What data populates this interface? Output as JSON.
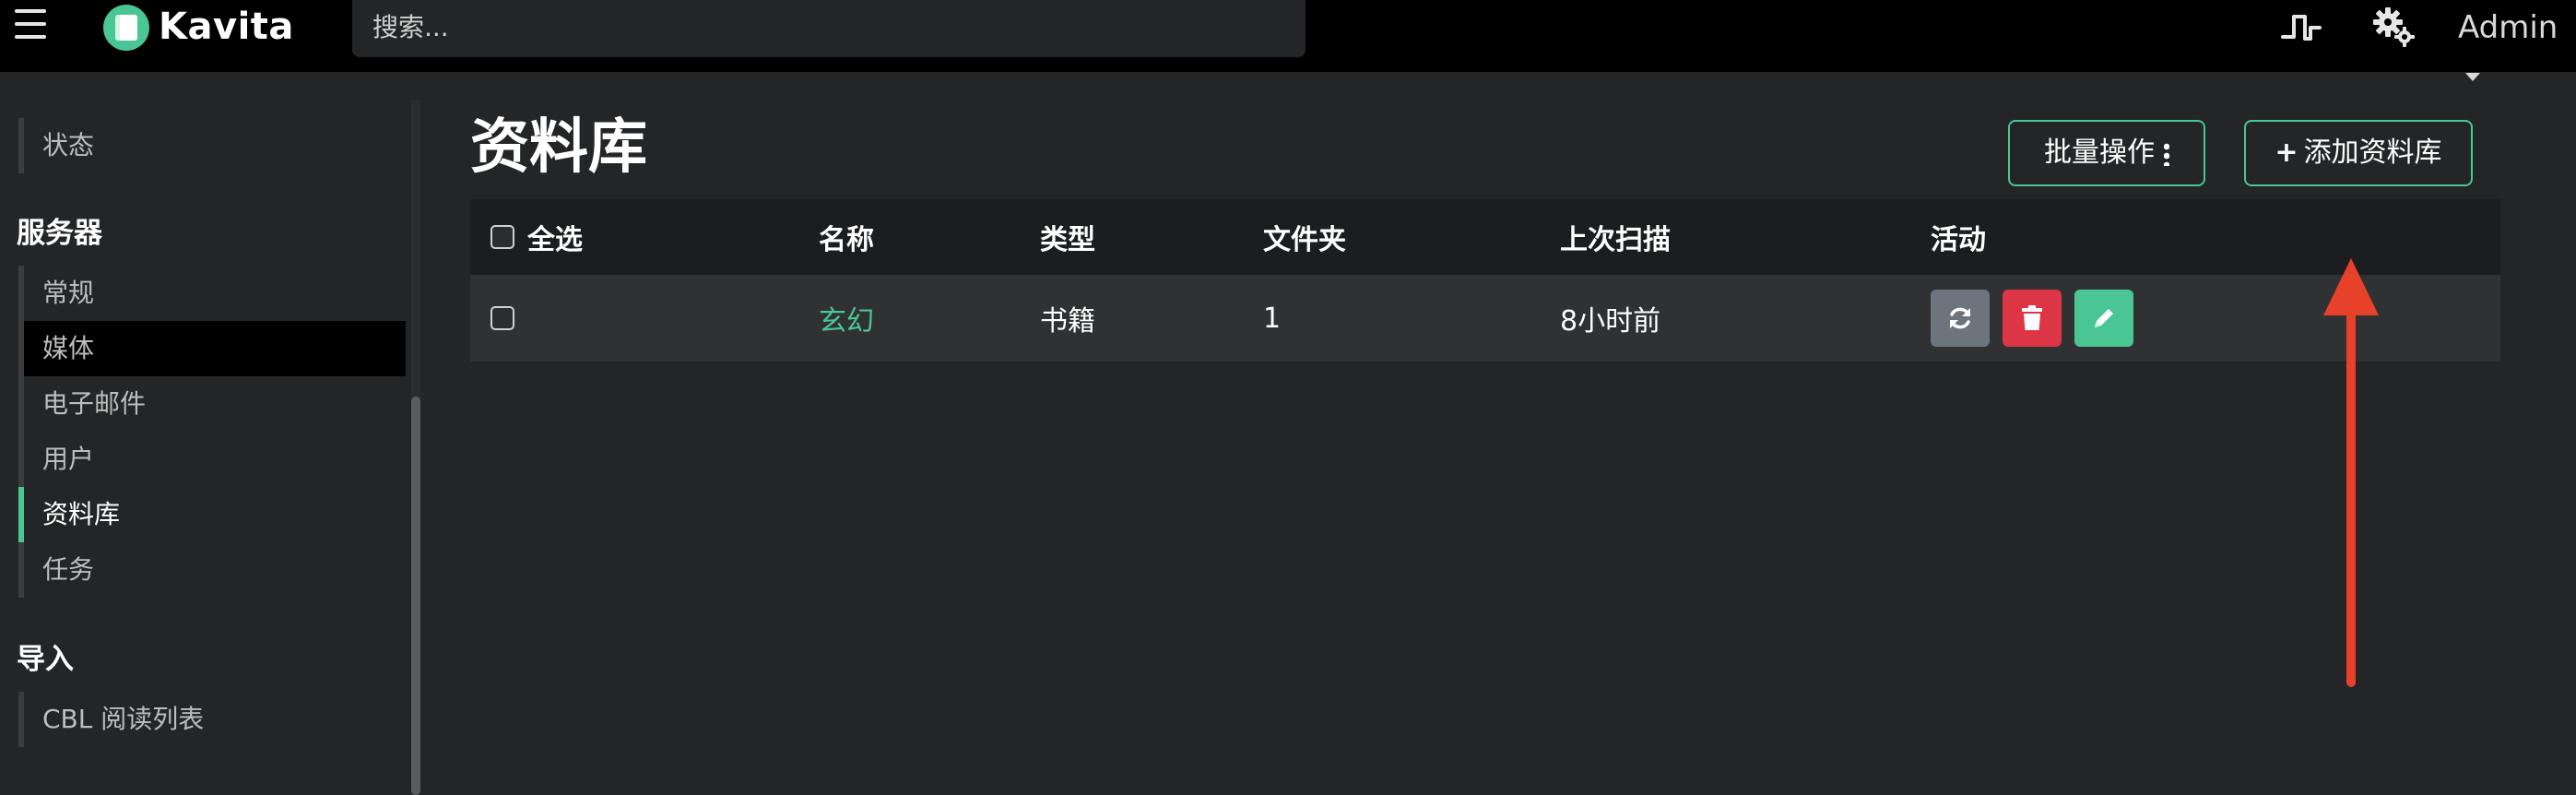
{
  "app": {
    "brand": "Kavita",
    "colors": {
      "accent": "#4ac694",
      "danger": "#dc3545",
      "secondary": "#6c757d",
      "annotation": "#e8412a"
    }
  },
  "topbar": {
    "search_placeholder": "搜索...",
    "icons": [
      "hamburger-icon",
      "kavita-logo",
      "pulse-icon",
      "gears-icon"
    ],
    "user_label": "Admin"
  },
  "sidebar": {
    "top_item": "状态",
    "server_heading": "服务器",
    "server_items": [
      {
        "label": "常规"
      },
      {
        "label": "媒体"
      },
      {
        "label": "电子邮件"
      },
      {
        "label": "用户"
      },
      {
        "label": "资料库"
      },
      {
        "label": "任务"
      }
    ],
    "import_heading": "导入",
    "import_items": [
      {
        "label": "CBL 阅读列表"
      }
    ]
  },
  "main": {
    "title": "资料库",
    "bulk_actions_label": "批量操作",
    "add_library_label": "添加资料库",
    "table": {
      "headers": {
        "select_all": "全选",
        "name": "名称",
        "type": "类型",
        "folders": "文件夹",
        "last_scan": "上次扫描",
        "actions": "活动"
      },
      "rows": [
        {
          "name": "玄幻",
          "type": "书籍",
          "folders": "1",
          "last_scan": "8小时前"
        }
      ]
    }
  }
}
